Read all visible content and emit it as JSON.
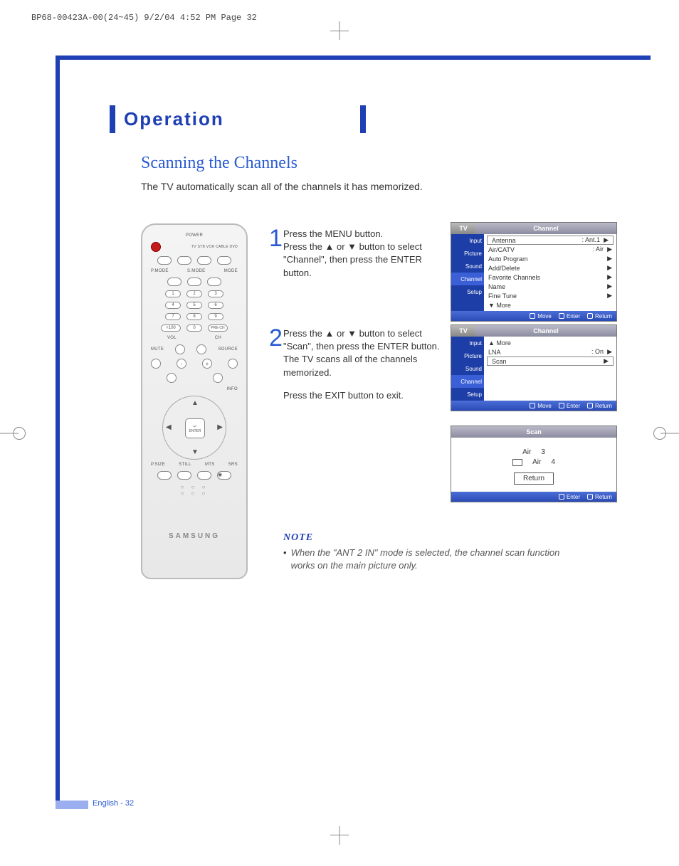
{
  "print_header": "BP68-00423A-00(24~45)  9/2/04  4:52 PM  Page 32",
  "section_heading": "Operation",
  "subheading": "Scanning the Channels",
  "intro": "The TV automatically scan all of the channels it has memorized.",
  "remote": {
    "power": "POWER",
    "device_labels": "TV  STB  VCR  CABLE  DVD",
    "mode_row": [
      "P.MODE",
      "S.MODE",
      "MODE"
    ],
    "num_rows": [
      [
        "1",
        "2",
        "3"
      ],
      [
        "4",
        "5",
        "6"
      ],
      [
        "7",
        "8",
        "9"
      ],
      [
        "+100",
        "0",
        "PRE-CH"
      ]
    ],
    "vol": "VOL",
    "ch": "CH",
    "mute": "MUTE",
    "source": "SOURCE",
    "info": "INFO",
    "enter_top": "↵",
    "enter_label": "ENTER",
    "bottom_row": [
      "P.SIZE",
      "STILL",
      "MTS",
      "SRS"
    ],
    "brand": "SAMSUNG"
  },
  "steps": {
    "s1_num": "1",
    "s1_text": "Press the MENU button.\nPress the ▲ or ▼ button to select \"Channel\", then press the ENTER button.",
    "s2_num": "2",
    "s2_text_a": "Press the ▲ or ▼ button to select \"Scan\", then press the ENTER button.\nThe TV scans all of the channels memorized.",
    "s2_text_b": "Press the EXIT button to exit."
  },
  "osd1": {
    "tab": "TV",
    "title": "Channel",
    "side": [
      "Input",
      "Picture",
      "Sound",
      "Channel",
      "Setup"
    ],
    "rows": [
      {
        "label": "Antenna",
        "value": ": Ant.1",
        "arrow": "▶"
      },
      {
        "label": "Air/CATV",
        "value": ": Air",
        "arrow": "▶"
      },
      {
        "label": "Auto Program",
        "value": "",
        "arrow": "▶"
      },
      {
        "label": "Add/Delete",
        "value": "",
        "arrow": "▶"
      },
      {
        "label": "Favorite Channels",
        "value": "",
        "arrow": "▶"
      },
      {
        "label": "Name",
        "value": "",
        "arrow": "▶"
      },
      {
        "label": "Fine Tune",
        "value": "",
        "arrow": "▶"
      },
      {
        "label": "▼ More",
        "value": "",
        "arrow": ""
      }
    ],
    "footer": [
      "Move",
      "Enter",
      "Return"
    ]
  },
  "osd2": {
    "tab": "TV",
    "title": "Channel",
    "side": [
      "Input",
      "Picture",
      "Sound",
      "Channel",
      "Setup"
    ],
    "rows": [
      {
        "label": "▲ More",
        "value": "",
        "arrow": ""
      },
      {
        "label": "LNA",
        "value": ": On",
        "arrow": "▶"
      },
      {
        "label": "Scan",
        "value": "",
        "arrow": "▶",
        "boxed": true
      }
    ],
    "footer": [
      "Move",
      "Enter",
      "Return"
    ]
  },
  "osd3": {
    "title": "Scan",
    "line1_label": "Air",
    "line1_val": "3",
    "line2_label": "Air",
    "line2_val": "4",
    "return": "Return",
    "footer": [
      "Enter",
      "Return"
    ]
  },
  "note": {
    "heading": "NOTE",
    "item": "When the \"ANT 2 IN\" mode is selected, the channel scan function works on the main picture only."
  },
  "page_footer": "English - 32"
}
